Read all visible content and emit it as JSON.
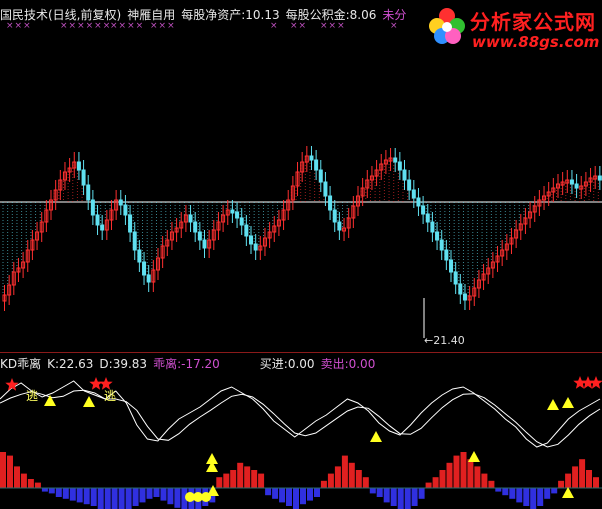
{
  "header": {
    "title": "国民技术(日线,前复权)",
    "indicator": "神雁自用",
    "nav_label": "每股净资产:",
    "nav_value": "10.13",
    "reserve_label": "每股公积金:",
    "reserve_value": "8.06",
    "undistributed": "未分",
    "x_marks": [
      "×××",
      "××××××",
      "××××",
      "×××",
      "×",
      "××",
      "×××",
      "×"
    ]
  },
  "price_panel": {
    "low_label": "←21.40",
    "colors": {
      "up": "#ff3030",
      "down": "#60e0f0",
      "baseline": "#ffffff"
    }
  },
  "indicator_panel": {
    "name": "KD乖离",
    "k_label": "K:",
    "k_value": "22.63",
    "d_label": "D:",
    "d_value": "39.83",
    "dev_label": "乖离:",
    "dev_value": "-17.20",
    "buy_label": "买进:",
    "buy_value": "0.00",
    "sell_label": "卖出:",
    "sell_value": "0.00",
    "escape_marks": [
      "逃",
      "逃"
    ]
  },
  "logo": {
    "name": "分析家公式网",
    "url": "www.88gs.com"
  },
  "icons": [
    "red-star-icon",
    "yellow-triangle-icon",
    "yellow-dot-icon",
    "flower-logo-icon"
  ]
}
